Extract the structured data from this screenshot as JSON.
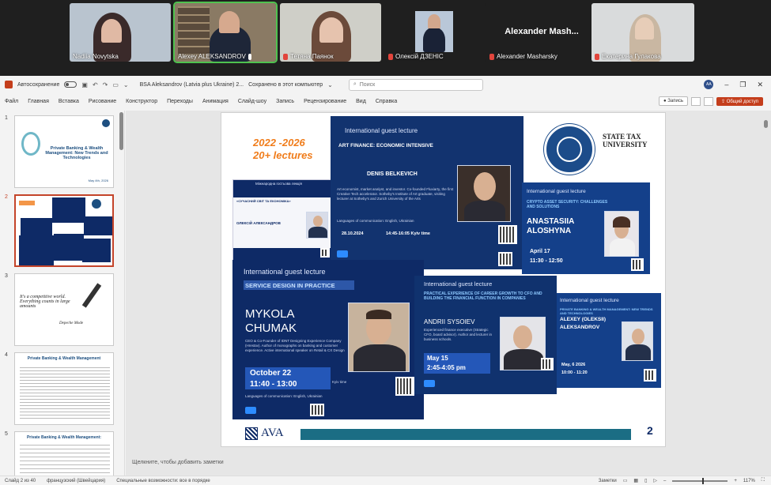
{
  "call": {
    "participants": [
      {
        "name": "Nadiia Novytska",
        "muted": false
      },
      {
        "name": "Alexey ALEKSANDROV",
        "muted": false,
        "active": true
      },
      {
        "name": "Тетяна Паянок",
        "muted": true
      },
      {
        "name": "Олексій ДЗЕНІС",
        "muted": true
      },
      {
        "name": "Alexander Masharsky",
        "muted": true,
        "big_label": "Alexander  Mash..."
      },
      {
        "name": "Екатерина Гулакова",
        "muted": true
      }
    ]
  },
  "titlebar": {
    "autosave": "Автосохранение",
    "document": "BSA Aleksandrov (Latvia plus Ukraine) 2...",
    "saved": "Сохранено в этот компьютер",
    "search_placeholder": "Поиск",
    "avatar_initials": "AA"
  },
  "menu": {
    "tabs": [
      "Файл",
      "Главная",
      "Вставка",
      "Рисование",
      "Конструктор",
      "Переходы",
      "Анимация",
      "Слайд-шоу",
      "Запись",
      "Рецензирование",
      "Вид",
      "Справка"
    ],
    "record_label": "Запись",
    "share_label": "Общий доступ"
  },
  "thumbnails": [
    {
      "num": "1",
      "title": "Private Banking & Wealth Management: New Trends and Technologies",
      "date": "May 4th, 2026"
    },
    {
      "num": "2"
    },
    {
      "num": "3",
      "quote": "It's a competitive world. Everything counts in large amounts",
      "author": "Depeche Mode"
    },
    {
      "num": "4",
      "title": "Private Banking & Wealth Management"
    },
    {
      "num": "5",
      "title": "Private Banking & Wealth Management:"
    }
  ],
  "slide": {
    "years": "2022 -2026",
    "lectures": "20+ lectures",
    "page_number": "2",
    "logo_text": "AVA",
    "university": "STATE TAX UNIVERSITY",
    "art": {
      "header": "International guest lecture",
      "title": "ART FINANCE: ECONOMIC INTENSIVE",
      "speaker": "DENIS BELKEVICH",
      "date": "28.10.2024",
      "time": "14:45-16:05 Kyiv time"
    },
    "crypto": {
      "header": "International guest lecture",
      "title": "CRYPTO ASSET SECURITY: CHALLENGES AND SOLUTIONS",
      "speaker_first": "ANASTASIIA",
      "speaker_last": "ALOSHYNA",
      "date": "April 17",
      "time": "11:30 - 12:50"
    },
    "ua": {
      "header": "Міжнародна гостьова лекція",
      "speaker": "ОЛЕКСІЙ АЛЕКСАНДРОВ"
    },
    "design": {
      "header": "International guest lecture",
      "title": "SERVICE DESIGN IN PRACTICE",
      "speaker_first": "MYKOLA",
      "speaker_last": "CHUMAK",
      "date": "October 22",
      "time": "11:40 - 13:00",
      "time_note": "Kyiv time"
    },
    "career": {
      "header": "International guest lecture",
      "title": "PRACTICAL EXPERIENCE OF CAREER GROWTH TO CFO AND BUILDING THE FINANCIAL FUNCTION IN COMPANIES",
      "speaker": "ANDRII SYSOIEV",
      "date": "May 15",
      "time": "2:45-4:05 pm"
    },
    "pb": {
      "header": "International guest lecture",
      "title": "PRIVATE BANKING & WEALTH MANAGEMENT: NEW TRENDS AND TECHNOLOGIES",
      "speaker_first": "ALEXEY (OLEKSII)",
      "speaker_last": "ALEKSANDROV",
      "date": "May, 6 2026",
      "time": "10:00 - 11:20"
    }
  },
  "notes_placeholder": "Щелкните, чтобы добавить заметки",
  "status": {
    "slide": "Слайд 2 из 40",
    "language": "французский (Швейцария)",
    "accessibility": "Специальные возможности: все в порядке",
    "notes": "Заметки",
    "zoom": "117%"
  },
  "colors": {
    "ppt_accent": "#c43e1c",
    "slide_navy": "#0e2a66",
    "orange": "#f07c1a",
    "teal": "#1b6d84"
  }
}
